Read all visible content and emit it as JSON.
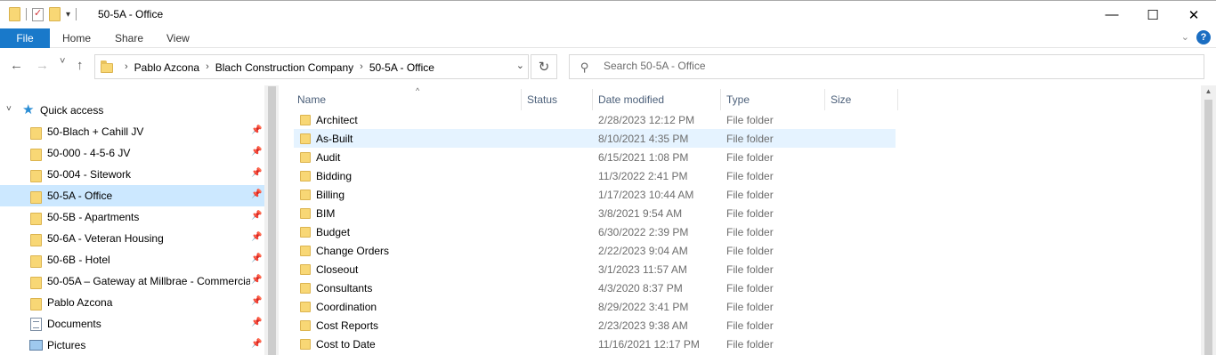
{
  "window": {
    "title": "50-5A - Office",
    "minimize": "—",
    "maximize": "☐",
    "close": "✕"
  },
  "ribbon": {
    "tabs": [
      "File",
      "Home",
      "Share",
      "View"
    ],
    "expand_icon": "chevron-down-icon",
    "help": "?"
  },
  "navigation": {
    "back": "←",
    "forward": "→",
    "recent": "˅",
    "up": "↑",
    "breadcrumb": [
      "Pablo Azcona",
      "Blach Construction Company",
      "50-5A - Office"
    ],
    "refresh": "↻"
  },
  "search": {
    "placeholder": "Search 50-5A - Office"
  },
  "nav_pane": {
    "quick_access_label": "Quick access",
    "items": [
      {
        "label": "50-Blach + Cahill JV",
        "icon": "folder-icon",
        "pinned": true
      },
      {
        "label": "50-000 - 4-5-6 JV",
        "icon": "folder-icon",
        "pinned": true
      },
      {
        "label": "50-004 - Sitework",
        "icon": "folder-icon",
        "pinned": true
      },
      {
        "label": "50-5A - Office",
        "icon": "folder-icon",
        "pinned": true,
        "selected": true
      },
      {
        "label": "50-5B - Apartments",
        "icon": "folder-icon",
        "pinned": true
      },
      {
        "label": "50-6A - Veteran Housing",
        "icon": "folder-icon",
        "pinned": true
      },
      {
        "label": "50-6B - Hotel",
        "icon": "folder-icon",
        "pinned": true
      },
      {
        "label": "50-05A – Gateway at Millbrae - Commercia",
        "icon": "folder-icon",
        "pinned": true
      },
      {
        "label": "Pablo Azcona",
        "icon": "folder-icon",
        "pinned": true
      },
      {
        "label": "Documents",
        "icon": "documents-icon",
        "pinned": true
      },
      {
        "label": "Pictures",
        "icon": "pictures-icon",
        "pinned": true
      }
    ]
  },
  "file_list": {
    "columns": [
      "Name",
      "Status",
      "Date modified",
      "Type",
      "Size"
    ],
    "sort_indicator": "^",
    "rows": [
      {
        "name": "Architect",
        "date": "2/28/2023 12:12 PM",
        "type": "File folder"
      },
      {
        "name": "As-Built",
        "date": "8/10/2021 4:35 PM",
        "type": "File folder",
        "hover": true
      },
      {
        "name": "Audit",
        "date": "6/15/2021 1:08 PM",
        "type": "File folder"
      },
      {
        "name": "Bidding",
        "date": "11/3/2022 2:41 PM",
        "type": "File folder"
      },
      {
        "name": "Billing",
        "date": "1/17/2023 10:44 AM",
        "type": "File folder"
      },
      {
        "name": "BIM",
        "date": "3/8/2021 9:54 AM",
        "type": "File folder"
      },
      {
        "name": "Budget",
        "date": "6/30/2022 2:39 PM",
        "type": "File folder"
      },
      {
        "name": "Change Orders",
        "date": "2/22/2023 9:04 AM",
        "type": "File folder"
      },
      {
        "name": "Closeout",
        "date": "3/1/2023 11:57 AM",
        "type": "File folder"
      },
      {
        "name": "Consultants",
        "date": "4/3/2020 8:37 PM",
        "type": "File folder"
      },
      {
        "name": "Coordination",
        "date": "8/29/2022 3:41 PM",
        "type": "File folder"
      },
      {
        "name": "Cost Reports",
        "date": "2/23/2023 9:38 AM",
        "type": "File folder"
      },
      {
        "name": "Cost to Date",
        "date": "11/16/2021 12:17 PM",
        "type": "File folder"
      }
    ]
  },
  "colors": {
    "accent": "#1979ca",
    "selected": "#cce8ff",
    "hover": "#e5f3ff",
    "folder": "#f8d775"
  }
}
